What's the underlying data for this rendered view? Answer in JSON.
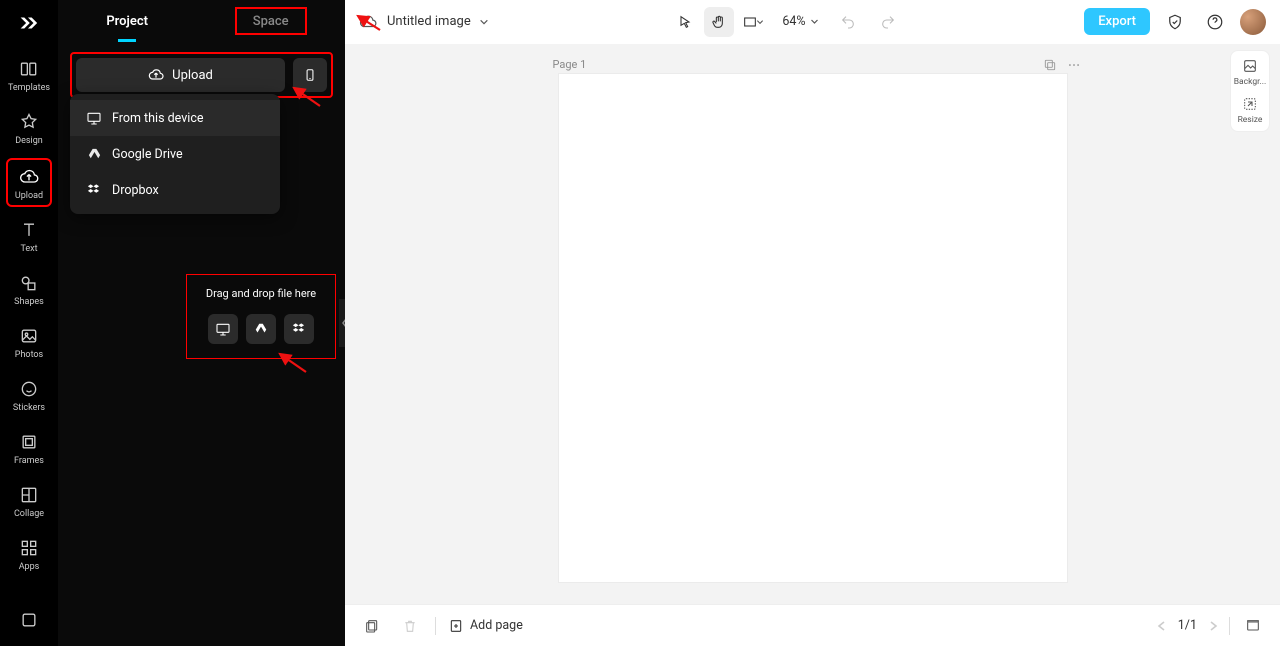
{
  "rail": {
    "items": [
      {
        "label": "Templates"
      },
      {
        "label": "Design"
      },
      {
        "label": "Upload"
      },
      {
        "label": "Text"
      },
      {
        "label": "Shapes"
      },
      {
        "label": "Photos"
      },
      {
        "label": "Stickers"
      },
      {
        "label": "Frames"
      },
      {
        "label": "Collage"
      },
      {
        "label": "Apps"
      }
    ]
  },
  "panel": {
    "tabs": {
      "project": "Project",
      "space": "Space"
    },
    "upload_label": "Upload",
    "menu": {
      "device": "From this device",
      "gdrive": "Google Drive",
      "dropbox": "Dropbox"
    },
    "dropzone_label": "Drag and drop file here"
  },
  "header": {
    "title": "Untitled image",
    "zoom": "64%",
    "export": "Export"
  },
  "canvas": {
    "page_label": "Page 1"
  },
  "right_tools": {
    "background": "Backgr...",
    "resize": "Resize"
  },
  "bottom": {
    "add_page": "Add page",
    "page_indicator": "1/1"
  }
}
